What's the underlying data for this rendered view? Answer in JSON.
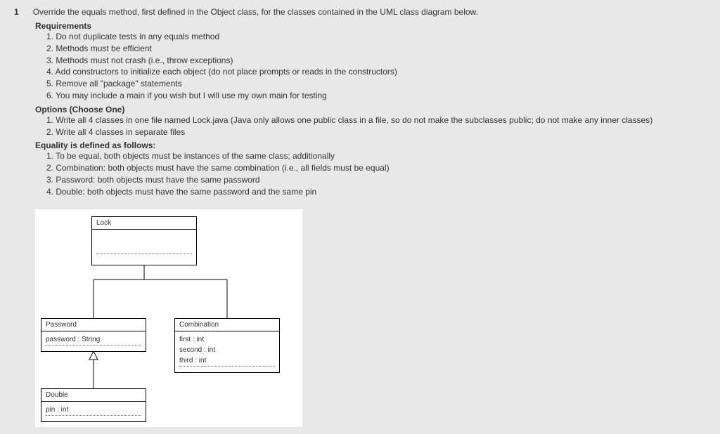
{
  "question_number": "1",
  "question_text": "Override the equals method, first defined in the Object class, for the classes contained in the UML class diagram below.",
  "requirements_title": "Requirements",
  "requirements": [
    "1. Do not duplicate tests in any equals method",
    "2. Methods must be efficient",
    "3. Methods must not crash (i.e., throw exceptions)",
    "4. Add constructors to initialize each object (do not place prompts or reads in the constructors)",
    "5. Remove all \"package\" statements",
    "6. You may include a main if you wish but I will use my own main for testing"
  ],
  "options_title": "Options (Choose One)",
  "options": [
    "1. Write all 4 classes in one file named Lock.java (Java only allows one public class in a file, so do not make the subclasses public; do not make any inner classes)",
    "2. Write all 4 classes in separate files"
  ],
  "equality_title": "Equality is defined as follows:",
  "equality": [
    "1. To be equal, both objects must be instances of the same class; additionally",
    "2. Combination: both objects must have the same combination (i.e., all fields must be equal)",
    "3. Password: both objects must have the same password",
    "4. Double: both objects must have the same password and the same pin"
  ],
  "uml": {
    "lock": {
      "name": "Lock"
    },
    "password": {
      "name": "Password",
      "attr1": "password : String"
    },
    "combination": {
      "name": "Combination",
      "attr1": "first : int",
      "attr2": "second : int",
      "attr3": "third : int"
    },
    "double": {
      "name": "Double",
      "attr1": "pin : int"
    }
  }
}
